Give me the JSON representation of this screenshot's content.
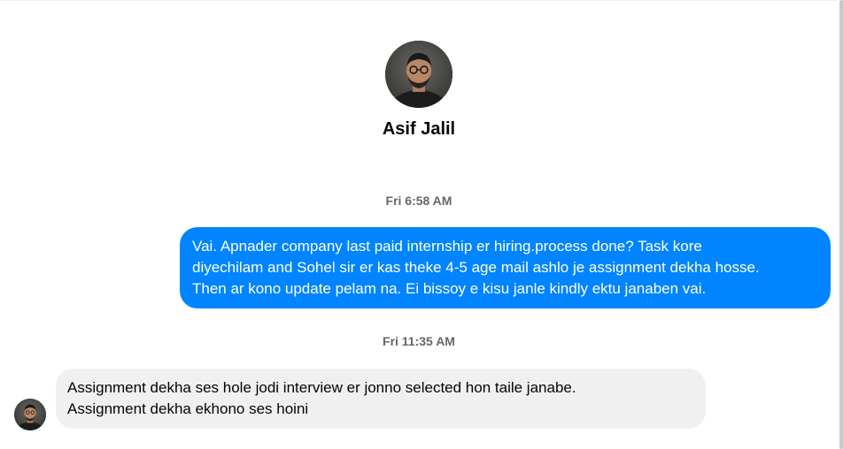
{
  "contact": {
    "name": "Asif Jalil",
    "avatar_icon": "profile-photo"
  },
  "conversation": {
    "timestamps": [
      "Fri 6:58 AM",
      "Fri 11:35 AM"
    ],
    "outgoing_message": {
      "lines": [
        "Vai. Apnader company last paid internship er hiring.process done? Task kore",
        "diyechilam and Sohel sir er kas theke 4-5 age mail ashlo je assignment dekha hosse.",
        "Then ar kono update pelam na. Ei bissoy e kisu janle kindly ektu janaben vai."
      ]
    },
    "incoming_message": {
      "lines": [
        "Assignment dekha ses hole jodi interview er jonno selected hon taile janabe.",
        "Assignment dekha ekhono ses hoini"
      ]
    }
  },
  "colors": {
    "outgoing_bubble": "#0084ff",
    "incoming_bubble": "#f0f0f0",
    "timestamp_text": "#65676b"
  }
}
